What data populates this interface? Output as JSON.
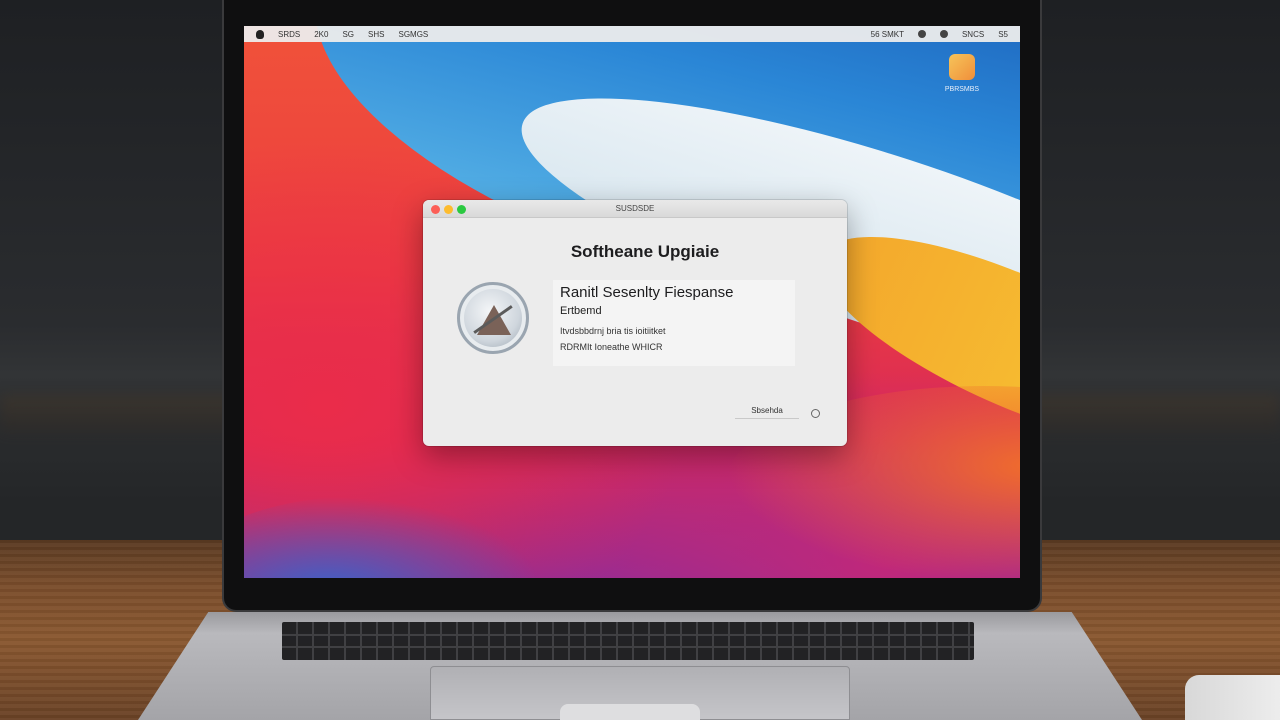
{
  "menubar": {
    "left_items": [
      "SRDS",
      "2K0",
      "SG",
      "SHS",
      "SGMGS"
    ],
    "right_items": [
      "56 SMKT",
      "SNCS",
      "S5"
    ]
  },
  "desktop_icon": {
    "label": "PBRSMBS"
  },
  "dialog": {
    "window_title": "SUSDSDE",
    "heading": "Softheane Upgiaie",
    "update_name": "Ranitl Sesenlty Fiespanse",
    "update_subtitle": "Ertbemd",
    "description_line1": "Itvdsbbdrnj bria tis ioitiitket",
    "description_line2": "RDRMIt Ioneathe WHICR",
    "action_button_label": "Sbsehda"
  },
  "colors": {
    "close": "#fc5f57",
    "minimize": "#fdbc2e",
    "zoom": "#2ac940"
  }
}
